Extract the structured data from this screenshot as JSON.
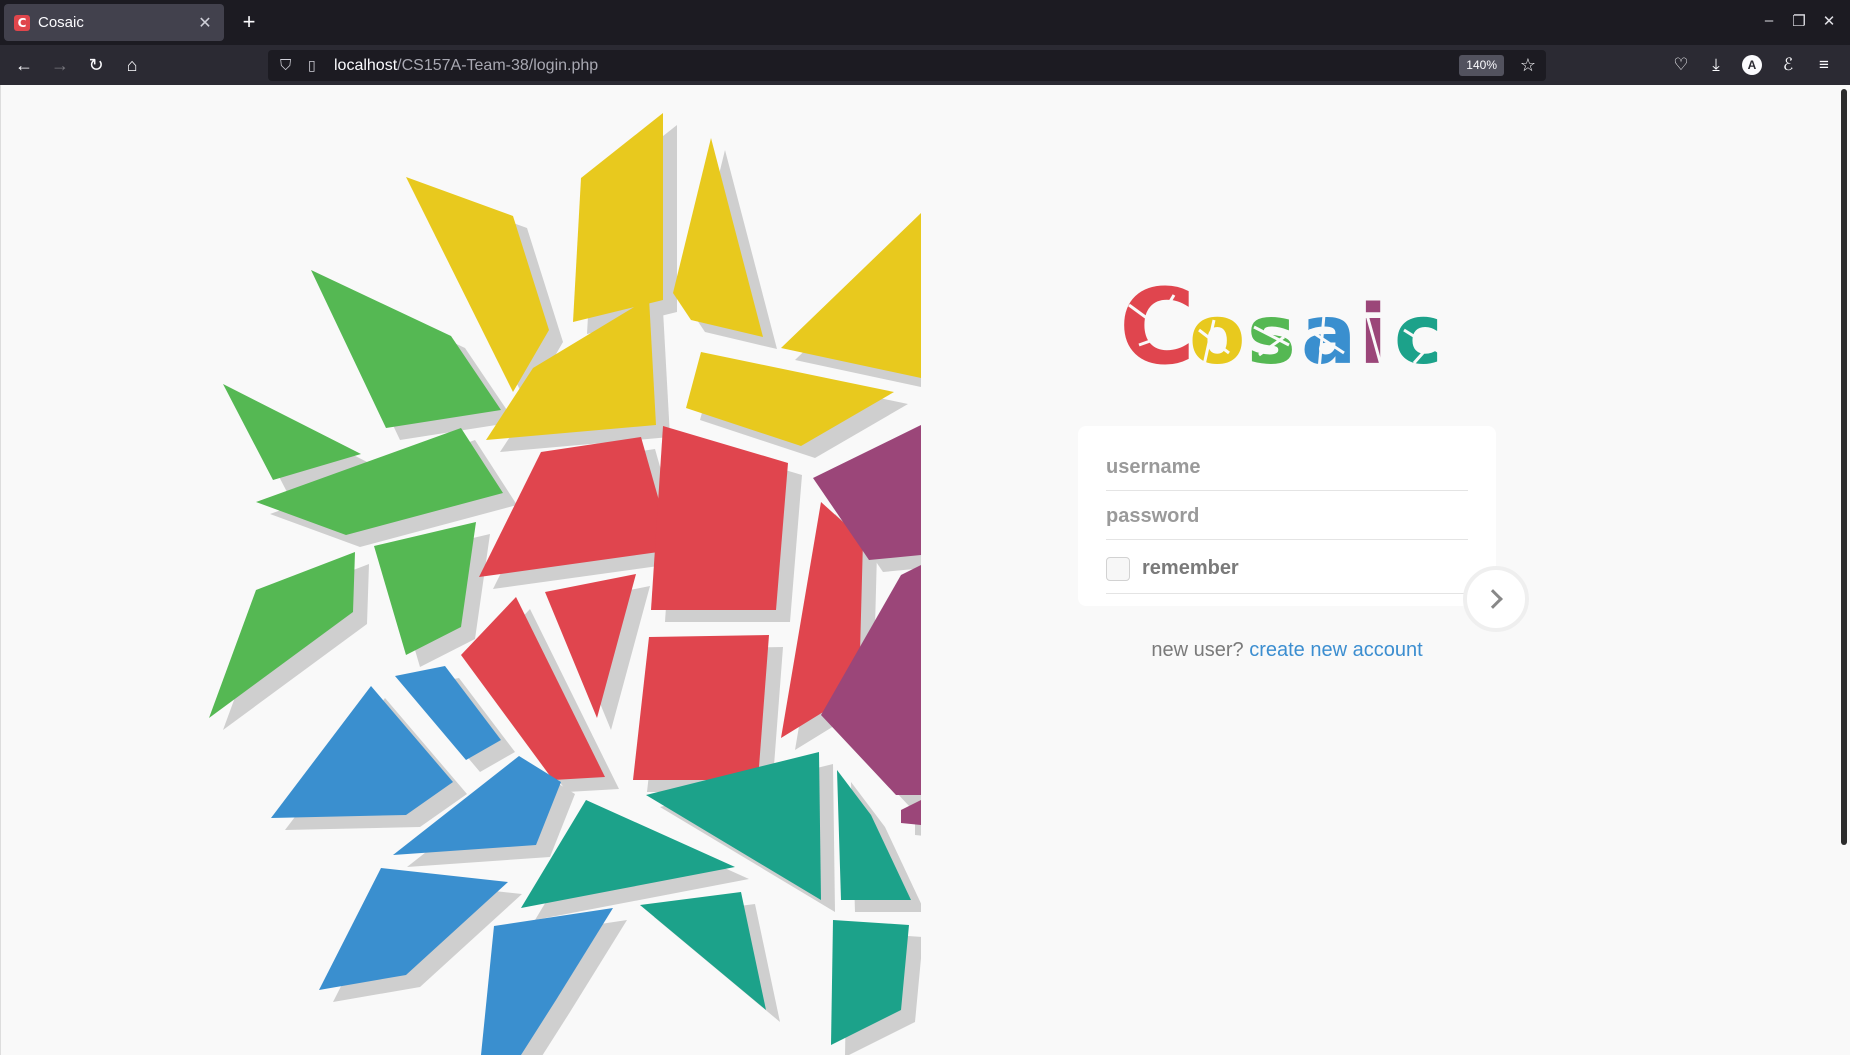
{
  "browser": {
    "tab": {
      "title": "Cosaic",
      "favicon_letter": "C"
    },
    "url": {
      "host": "localhost",
      "path": "/CS157A-Team-38/login.php"
    },
    "zoom": "140%"
  },
  "logo": {
    "letters": [
      {
        "char": "C",
        "color": "#e0454e"
      },
      {
        "char": "o",
        "color": "#e8c91e"
      },
      {
        "char": "s",
        "color": "#55b853"
      },
      {
        "char": "a",
        "color": "#3a8fcf"
      },
      {
        "char": "i",
        "color": "#9b4679"
      },
      {
        "char": "c",
        "color": "#1ca28a"
      }
    ]
  },
  "login": {
    "username_placeholder": "username",
    "password_placeholder": "password",
    "remember_label": "remember"
  },
  "signup": {
    "prompt": "new user?",
    "link": "create new account"
  },
  "colors": {
    "yellow": "#e8c91e",
    "green": "#55b853",
    "red": "#e0454e",
    "blue": "#3a8fcf",
    "teal": "#1ca28a",
    "purple": "#9b4679",
    "shadow": "#cfcfcf",
    "page_bg": "#f9f9f9"
  }
}
